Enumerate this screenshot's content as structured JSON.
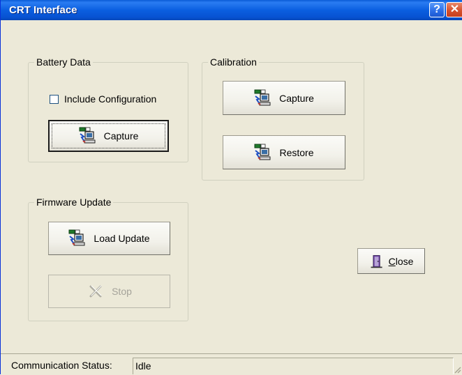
{
  "window": {
    "title": "CRT Interface"
  },
  "battery_data": {
    "label": "Battery Data",
    "include_configuration": {
      "label": "Include Configuration",
      "checked": false
    },
    "capture_label": "Capture"
  },
  "calibration": {
    "label": "Calibration",
    "capture_label": "Capture",
    "restore_label": "Restore"
  },
  "firmware_update": {
    "label": "Firmware Update",
    "load_update_label": "Load Update",
    "stop_label": "Stop"
  },
  "close_label_initial": "C",
  "close_label_rest": "lose",
  "status": {
    "label": "Communication Status:",
    "value": "Idle"
  },
  "icons": {
    "title_help": "help-icon",
    "title_close": "close-icon",
    "capture": "computer-transfer-icon",
    "stop": "stop-x-icon",
    "close": "door-exit-icon"
  }
}
